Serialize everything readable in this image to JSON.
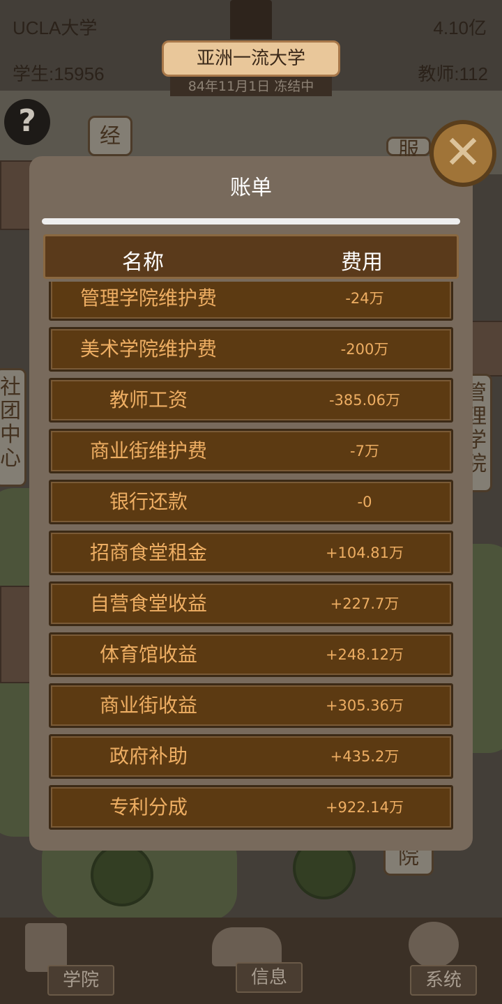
{
  "hud": {
    "school_name": "UCLA大学",
    "funds": "4.10亿",
    "students": "学生:15956",
    "teachers": "教师:112",
    "rank_title": "亚洲一流大学",
    "date_status": "84年11月1日 冻结中"
  },
  "scene_signs": {
    "top_left": "经",
    "left": "社团中心",
    "right": "管理学院",
    "right_partial": "院",
    "top_right": "服"
  },
  "help_icon": "question-mark-icon",
  "modal": {
    "title": "账单",
    "close_icon": "close-x-icon",
    "columns": {
      "name": "名称",
      "fee": "费用"
    },
    "rows": [
      {
        "name": "管理学院维护费",
        "fee": "-24万"
      },
      {
        "name": "美术学院维护费",
        "fee": "-200万"
      },
      {
        "name": "教师工资",
        "fee": "-385.06万"
      },
      {
        "name": "商业街维护费",
        "fee": "-7万"
      },
      {
        "name": "银行还款",
        "fee": "-0"
      },
      {
        "name": "招商食堂租金",
        "fee": "+104.81万"
      },
      {
        "name": "自营食堂收益",
        "fee": "+227.7万"
      },
      {
        "name": "体育馆收益",
        "fee": "+248.12万"
      },
      {
        "name": "商业街收益",
        "fee": "+305.36万"
      },
      {
        "name": "政府补助",
        "fee": "+435.2万"
      },
      {
        "name": "专利分成",
        "fee": "+922.14万"
      }
    ]
  },
  "bottom_nav": {
    "college": "学院",
    "info": "信息",
    "system": "系统"
  }
}
